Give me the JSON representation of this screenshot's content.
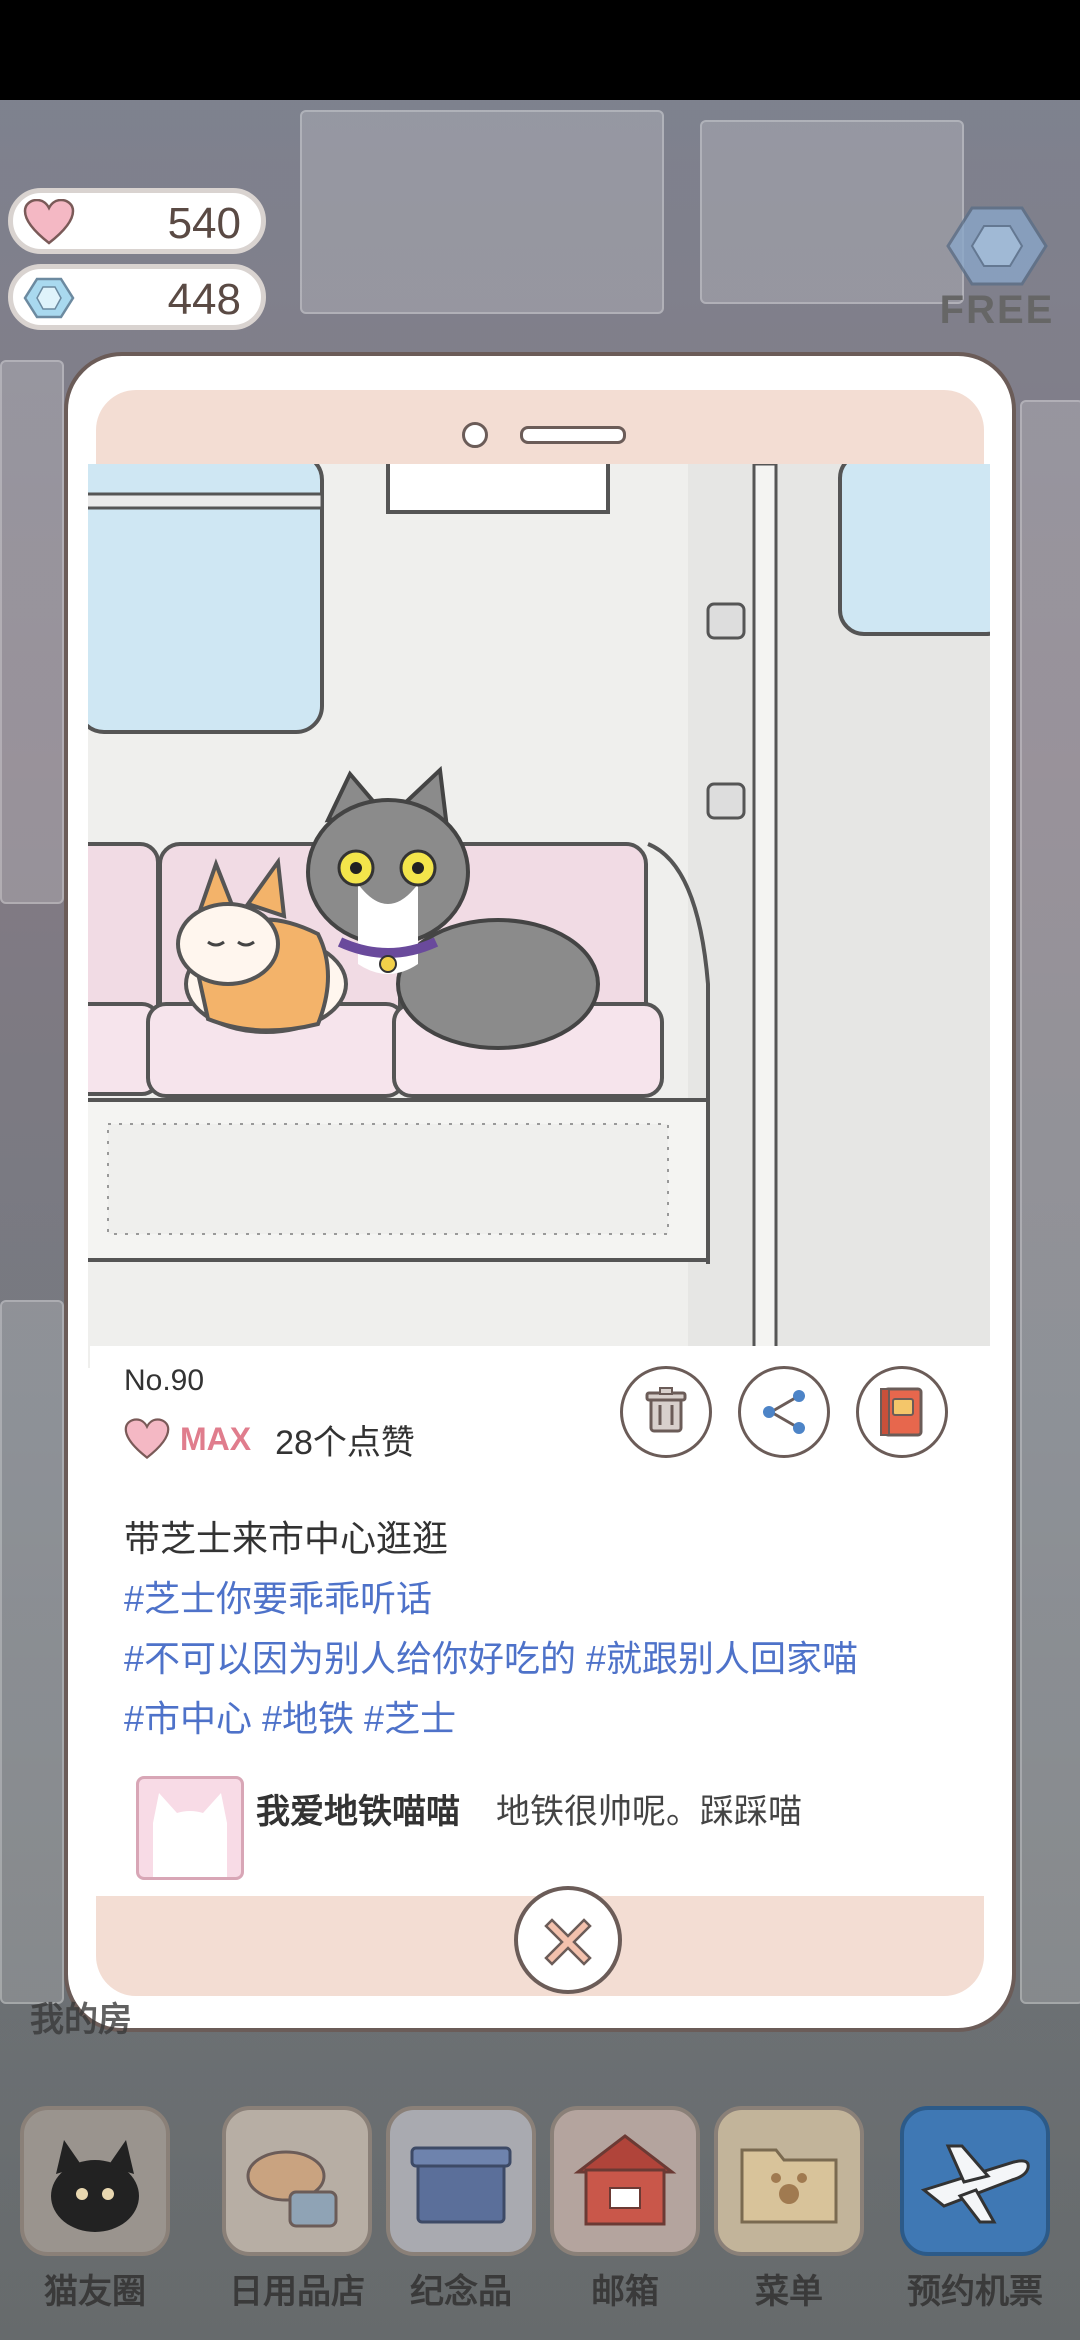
{
  "currency": {
    "hearts": "540",
    "gems": "448"
  },
  "free_badge": "FREE",
  "post": {
    "number": "No.90",
    "like_level": "MAX",
    "like_count": "28个点赞",
    "caption": "带芝士来市中心逛逛",
    "tag_lines": [
      "#芝士你要乖乖听话",
      "#不可以因为别人给你好吃的 #就跟别人回家喵",
      "#市中心 #地铁 #芝士"
    ],
    "comment": {
      "user": "我爱地铁喵喵",
      "text": "地铁很帅呢。踩踩喵"
    }
  },
  "room_label": "我的房",
  "nav": [
    {
      "label": "猫友圈",
      "icon": "cat-camera-icon"
    },
    {
      "label": "日用品店",
      "icon": "shop-icon"
    },
    {
      "label": "纪念品",
      "icon": "souvenir-box-icon"
    },
    {
      "label": "邮箱",
      "icon": "mailbox-icon"
    },
    {
      "label": "菜单",
      "icon": "menu-folder-icon"
    },
    {
      "label": "预约机票",
      "icon": "airplane-icon"
    }
  ],
  "colors": {
    "accent_pink": "#e07d8d",
    "tag_blue": "#4e72c9",
    "phone_frame": "#f3ddd3"
  }
}
